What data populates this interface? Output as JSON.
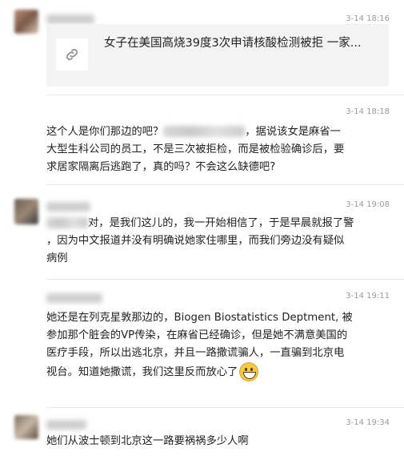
{
  "messages": [
    {
      "time": "3-14 18:16",
      "link": {
        "title": "女子在美国高烧39度3次申请核酸检测被拒 一家..."
      }
    },
    {
      "time": "3-14 18:18",
      "lines": [
        [
          "这个人是你们那边的吧？",
          "",
          "，据说该女是麻省一"
        ],
        [
          "大型生科公司的员工，不是三次被拒检，而是被检验确诊后，要"
        ],
        [
          "求居家隔离后逃跑了，真的吗？不会这么缺德吧?"
        ]
      ]
    },
    {
      "time": "3-14 19:08",
      "lines": [
        [
          "",
          "对，是我们这儿的，我一开始相信了，于是早晨就报了警"
        ],
        [
          "，因为中文报道并没有明确说她家住哪里，而我们旁边没有疑似"
        ],
        [
          "病例"
        ]
      ]
    },
    {
      "time": "3-14 19:11",
      "lines": [
        [
          "她还是在列克星敦那边的，Biogen Biostatistics Deptment, 被"
        ],
        [
          "参加那个脏会的VP传染，在麻省已经确诊，但是她不满意美国的"
        ],
        [
          "医疗手段，所以出逃北京，并且一路撒谎骗人，一直骗到北京电"
        ],
        [
          "视台。知道她撒谎，我们这里反而放心了"
        ]
      ]
    },
    {
      "time": "3-14 19:34",
      "lines": [
        [
          "她们从波士顿到北京这一路要祸祸多少人啊"
        ]
      ]
    }
  ],
  "icons": {
    "link": "link-icon",
    "emoji": "grinning-face-icon"
  }
}
